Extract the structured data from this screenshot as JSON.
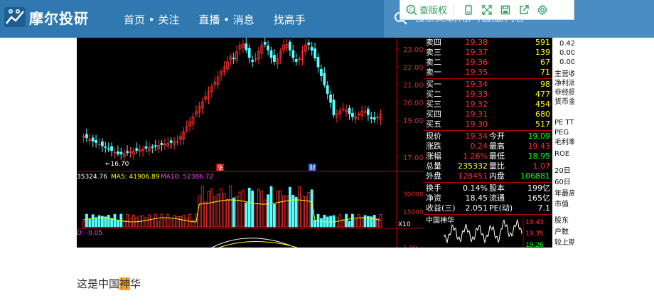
{
  "brand": {
    "name": "摩尔投研"
  },
  "nav": {
    "items": [
      "首页 • 关注",
      "直播 • 消息",
      "找高手"
    ]
  },
  "search": {
    "placeholder": "搜索文章/用户/直播/问答"
  },
  "toolbar": {
    "check_label": "查版权"
  },
  "stock": {
    "price_ticks": [
      "23.00",
      "22.00",
      "21.00",
      "20.00",
      "19.00",
      "17.00"
    ],
    "low_label": "16.70",
    "vol_ticks": [
      "30000",
      "15000",
      "X10"
    ],
    "indicator_label": "-0.05",
    "indicator_tick": "1.00",
    "ma_labels": [
      {
        "text": "35324.76",
        "color": "#ffffff"
      },
      {
        "text": "MA5: 41906.89",
        "color": "#ffff00"
      },
      {
        "text": "MA10: 52386.72",
        "color": "#ff44ff"
      }
    ],
    "markers": [
      "涨",
      "财"
    ],
    "ask": [
      {
        "label": "卖四",
        "price": "19.38",
        "vol": "591"
      },
      {
        "label": "卖三",
        "price": "19.37",
        "vol": "139"
      },
      {
        "label": "卖二",
        "price": "19.36",
        "vol": "67"
      },
      {
        "label": "卖一",
        "price": "19.35",
        "vol": "71"
      }
    ],
    "bid": [
      {
        "label": "买一",
        "price": "19.34",
        "vol": "98"
      },
      {
        "label": "买二",
        "price": "19.33",
        "vol": "477"
      },
      {
        "label": "买三",
        "price": "19.32",
        "vol": "454"
      },
      {
        "label": "买四",
        "price": "19.31",
        "vol": "680"
      },
      {
        "label": "买五",
        "price": "19.30",
        "vol": "517"
      }
    ],
    "stats": [
      {
        "l1": "现价",
        "v1": "19.34",
        "c1": "#ff3030",
        "l2": "今开",
        "v2": "19.09",
        "c2": "#00ff00"
      },
      {
        "l1": "涨跌",
        "v1": "0.24",
        "c1": "#ff3030",
        "l2": "最高",
        "v2": "19.43",
        "c2": "#ff3030"
      },
      {
        "l1": "涨幅",
        "v1": "1.26%",
        "c1": "#ff3030",
        "l2": "最低",
        "v2": "18.95",
        "c2": "#00ff00"
      },
      {
        "l1": "总量",
        "v1": "235332",
        "c1": "#ffff00",
        "l2": "量比",
        "v2": "1.07",
        "c2": "#ff3030"
      },
      {
        "l1": "外盘",
        "v1": "128451",
        "c1": "#ff3030",
        "l2": "内盘",
        "v2": "106881",
        "c2": "#00ff00"
      }
    ],
    "fin": [
      {
        "l1": "换手",
        "v1": "0.14%",
        "l2": "股本",
        "v2": "199亿"
      },
      {
        "l1": "净资",
        "v1": "18.45",
        "l2": "流通",
        "v2": "165亿"
      },
      {
        "l1": "收益(三)",
        "v1": "2.051",
        "l2": "PE(动)",
        "v2": "7.1"
      }
    ],
    "mini_title": "中国神华",
    "mini_ticks": [
      "19.43",
      "19.35",
      "19.26"
    ],
    "side_labels": [
      "0.42",
      "0.00",
      "0.00",
      "主营收",
      "净利润",
      "非经损",
      "货币金",
      "PE TTM",
      "PEG",
      "毛利率",
      "ROE",
      "20日",
      "60日",
      "年最高",
      "市值",
      "股东",
      "户数",
      "较上期"
    ]
  },
  "caption": {
    "before": "这是中国",
    "highlight": "神",
    "after": "华"
  }
}
